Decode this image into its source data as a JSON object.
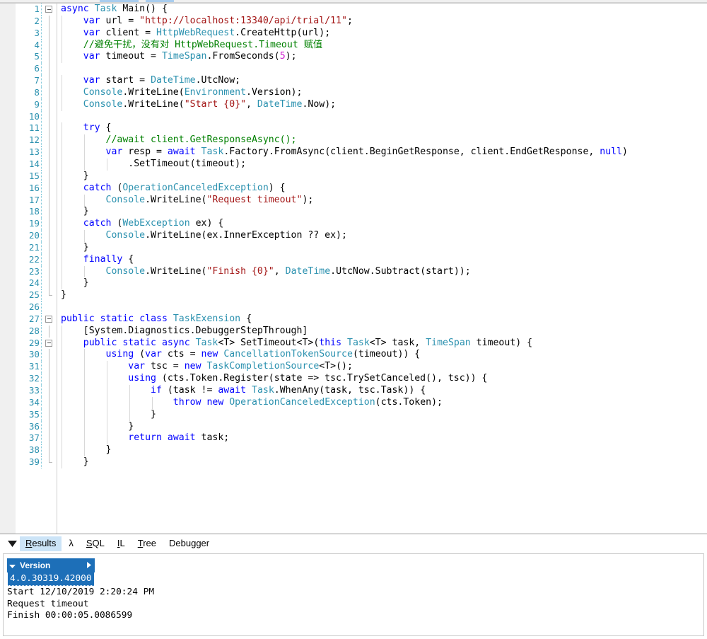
{
  "window": {
    "app": "LINQPad C# Program Editor"
  },
  "editor": {
    "first_line_number": 1,
    "last_line_number": 39,
    "lines": [
      {
        "num": "1",
        "fold": "open",
        "tokens": [
          {
            "t": "k",
            "v": "async"
          },
          {
            "t": "p",
            "v": " "
          },
          {
            "t": "t",
            "v": "Task"
          },
          {
            "t": "p",
            "v": " Main() {"
          }
        ]
      },
      {
        "num": "2",
        "fold": "bar",
        "tokens": [
          {
            "t": "p",
            "v": "    "
          },
          {
            "t": "k",
            "v": "var"
          },
          {
            "t": "p",
            "v": " url = "
          },
          {
            "t": "s",
            "v": "\"http://localhost:13340/api/trial/11\""
          },
          {
            "t": "p",
            "v": ";"
          }
        ]
      },
      {
        "num": "3",
        "fold": "bar",
        "tokens": [
          {
            "t": "p",
            "v": "    "
          },
          {
            "t": "k",
            "v": "var"
          },
          {
            "t": "p",
            "v": " client = "
          },
          {
            "t": "t",
            "v": "HttpWebRequest"
          },
          {
            "t": "p",
            "v": ".CreateHttp(url);"
          }
        ]
      },
      {
        "num": "4",
        "fold": "bar",
        "tokens": [
          {
            "t": "p",
            "v": "    "
          },
          {
            "t": "c",
            "v": "//避免干扰，没有对 HttpWebRequest.Timeout 赋值"
          }
        ]
      },
      {
        "num": "5",
        "fold": "bar",
        "tokens": [
          {
            "t": "p",
            "v": "    "
          },
          {
            "t": "k",
            "v": "var"
          },
          {
            "t": "p",
            "v": " timeout = "
          },
          {
            "t": "t",
            "v": "TimeSpan"
          },
          {
            "t": "p",
            "v": ".FromSeconds("
          },
          {
            "t": "n",
            "v": "5"
          },
          {
            "t": "p",
            "v": ");"
          }
        ]
      },
      {
        "num": "6",
        "fold": "bar",
        "tokens": [
          {
            "t": "p",
            "v": ""
          }
        ]
      },
      {
        "num": "7",
        "fold": "bar",
        "tokens": [
          {
            "t": "p",
            "v": "    "
          },
          {
            "t": "k",
            "v": "var"
          },
          {
            "t": "p",
            "v": " start = "
          },
          {
            "t": "t",
            "v": "DateTime"
          },
          {
            "t": "p",
            "v": ".UtcNow;"
          }
        ]
      },
      {
        "num": "8",
        "fold": "bar",
        "tokens": [
          {
            "t": "p",
            "v": "    "
          },
          {
            "t": "t",
            "v": "Console"
          },
          {
            "t": "p",
            "v": ".WriteLine("
          },
          {
            "t": "t",
            "v": "Environment"
          },
          {
            "t": "p",
            "v": ".Version);"
          }
        ]
      },
      {
        "num": "9",
        "fold": "bar",
        "tokens": [
          {
            "t": "p",
            "v": "    "
          },
          {
            "t": "t",
            "v": "Console"
          },
          {
            "t": "p",
            "v": ".WriteLine("
          },
          {
            "t": "s",
            "v": "\"Start {0}\""
          },
          {
            "t": "p",
            "v": ", "
          },
          {
            "t": "t",
            "v": "DateTime"
          },
          {
            "t": "p",
            "v": ".Now);"
          }
        ]
      },
      {
        "num": "10",
        "fold": "bar",
        "tokens": [
          {
            "t": "p",
            "v": ""
          }
        ]
      },
      {
        "num": "11",
        "fold": "bar",
        "tokens": [
          {
            "t": "p",
            "v": "    "
          },
          {
            "t": "k",
            "v": "try"
          },
          {
            "t": "p",
            "v": " {"
          }
        ]
      },
      {
        "num": "12",
        "fold": "bar",
        "tokens": [
          {
            "t": "p",
            "v": "        "
          },
          {
            "t": "c",
            "v": "//await client.GetResponseAsync();"
          }
        ]
      },
      {
        "num": "13",
        "fold": "bar",
        "tokens": [
          {
            "t": "p",
            "v": "        "
          },
          {
            "t": "k",
            "v": "var"
          },
          {
            "t": "p",
            "v": " resp = "
          },
          {
            "t": "k",
            "v": "await"
          },
          {
            "t": "p",
            "v": " "
          },
          {
            "t": "t",
            "v": "Task"
          },
          {
            "t": "p",
            "v": ".Factory.FromAsync(client.BeginGetResponse, client.EndGetResponse, "
          },
          {
            "t": "k",
            "v": "null"
          },
          {
            "t": "p",
            "v": ")"
          }
        ]
      },
      {
        "num": "14",
        "fold": "bar",
        "tokens": [
          {
            "t": "p",
            "v": "            .SetTimeout(timeout);"
          }
        ]
      },
      {
        "num": "15",
        "fold": "bar",
        "tokens": [
          {
            "t": "p",
            "v": "    }"
          }
        ]
      },
      {
        "num": "16",
        "fold": "bar",
        "tokens": [
          {
            "t": "p",
            "v": "    "
          },
          {
            "t": "k",
            "v": "catch"
          },
          {
            "t": "p",
            "v": " ("
          },
          {
            "t": "t",
            "v": "OperationCanceledException"
          },
          {
            "t": "p",
            "v": ") {"
          }
        ]
      },
      {
        "num": "17",
        "fold": "bar",
        "tokens": [
          {
            "t": "p",
            "v": "        "
          },
          {
            "t": "t",
            "v": "Console"
          },
          {
            "t": "p",
            "v": ".WriteLine("
          },
          {
            "t": "s",
            "v": "\"Request timeout\""
          },
          {
            "t": "p",
            "v": ");"
          }
        ]
      },
      {
        "num": "18",
        "fold": "bar",
        "tokens": [
          {
            "t": "p",
            "v": "    }"
          }
        ]
      },
      {
        "num": "19",
        "fold": "bar",
        "tokens": [
          {
            "t": "p",
            "v": "    "
          },
          {
            "t": "k",
            "v": "catch"
          },
          {
            "t": "p",
            "v": " ("
          },
          {
            "t": "t",
            "v": "WebException"
          },
          {
            "t": "p",
            "v": " ex) {"
          }
        ]
      },
      {
        "num": "20",
        "fold": "bar",
        "tokens": [
          {
            "t": "p",
            "v": "        "
          },
          {
            "t": "t",
            "v": "Console"
          },
          {
            "t": "p",
            "v": ".WriteLine(ex.InnerException ?? ex);"
          }
        ]
      },
      {
        "num": "21",
        "fold": "bar",
        "tokens": [
          {
            "t": "p",
            "v": "    }"
          }
        ]
      },
      {
        "num": "22",
        "fold": "bar",
        "tokens": [
          {
            "t": "p",
            "v": "    "
          },
          {
            "t": "k",
            "v": "finally"
          },
          {
            "t": "p",
            "v": " {"
          }
        ]
      },
      {
        "num": "23",
        "fold": "bar",
        "tokens": [
          {
            "t": "p",
            "v": "        "
          },
          {
            "t": "t",
            "v": "Console"
          },
          {
            "t": "p",
            "v": ".WriteLine("
          },
          {
            "t": "s",
            "v": "\"Finish {0}\""
          },
          {
            "t": "p",
            "v": ", "
          },
          {
            "t": "t",
            "v": "DateTime"
          },
          {
            "t": "p",
            "v": ".UtcNow.Subtract(start));"
          }
        ]
      },
      {
        "num": "24",
        "fold": "bar",
        "tokens": [
          {
            "t": "p",
            "v": "    }"
          }
        ]
      },
      {
        "num": "25",
        "fold": "end",
        "tokens": [
          {
            "t": "p",
            "v": "}"
          }
        ]
      },
      {
        "num": "26",
        "fold": "none",
        "tokens": [
          {
            "t": "p",
            "v": ""
          }
        ]
      },
      {
        "num": "27",
        "fold": "open",
        "tokens": [
          {
            "t": "k",
            "v": "public"
          },
          {
            "t": "p",
            "v": " "
          },
          {
            "t": "k",
            "v": "static"
          },
          {
            "t": "p",
            "v": " "
          },
          {
            "t": "k",
            "v": "class"
          },
          {
            "t": "p",
            "v": " "
          },
          {
            "t": "t",
            "v": "TaskExension"
          },
          {
            "t": "p",
            "v": " {"
          }
        ]
      },
      {
        "num": "28",
        "fold": "bar",
        "tokens": [
          {
            "t": "p",
            "v": "    [System.Diagnostics.DebuggerStepThrough]"
          }
        ]
      },
      {
        "num": "29",
        "fold": "open2",
        "tokens": [
          {
            "t": "p",
            "v": "    "
          },
          {
            "t": "k",
            "v": "public"
          },
          {
            "t": "p",
            "v": " "
          },
          {
            "t": "k",
            "v": "static"
          },
          {
            "t": "p",
            "v": " "
          },
          {
            "t": "k",
            "v": "async"
          },
          {
            "t": "p",
            "v": " "
          },
          {
            "t": "t",
            "v": "Task"
          },
          {
            "t": "p",
            "v": "<T> SetTimeout<T>("
          },
          {
            "t": "k",
            "v": "this"
          },
          {
            "t": "p",
            "v": " "
          },
          {
            "t": "t",
            "v": "Task"
          },
          {
            "t": "p",
            "v": "<T> task, "
          },
          {
            "t": "t",
            "v": "TimeSpan"
          },
          {
            "t": "p",
            "v": " timeout) {"
          }
        ]
      },
      {
        "num": "30",
        "fold": "bar2",
        "tokens": [
          {
            "t": "p",
            "v": "        "
          },
          {
            "t": "k",
            "v": "using"
          },
          {
            "t": "p",
            "v": " ("
          },
          {
            "t": "k",
            "v": "var"
          },
          {
            "t": "p",
            "v": " cts = "
          },
          {
            "t": "k",
            "v": "new"
          },
          {
            "t": "p",
            "v": " "
          },
          {
            "t": "t",
            "v": "CancellationTokenSource"
          },
          {
            "t": "p",
            "v": "(timeout)) {"
          }
        ]
      },
      {
        "num": "31",
        "fold": "bar2",
        "tokens": [
          {
            "t": "p",
            "v": "            "
          },
          {
            "t": "k",
            "v": "var"
          },
          {
            "t": "p",
            "v": " tsc = "
          },
          {
            "t": "k",
            "v": "new"
          },
          {
            "t": "p",
            "v": " "
          },
          {
            "t": "t",
            "v": "TaskCompletionSource"
          },
          {
            "t": "p",
            "v": "<T>();"
          }
        ]
      },
      {
        "num": "32",
        "fold": "bar2",
        "tokens": [
          {
            "t": "p",
            "v": "            "
          },
          {
            "t": "k",
            "v": "using"
          },
          {
            "t": "p",
            "v": " (cts.Token.Register(state => tsc.TrySetCanceled(), tsc)) {"
          }
        ]
      },
      {
        "num": "33",
        "fold": "bar2",
        "tokens": [
          {
            "t": "p",
            "v": "                "
          },
          {
            "t": "k",
            "v": "if"
          },
          {
            "t": "p",
            "v": " (task != "
          },
          {
            "t": "k",
            "v": "await"
          },
          {
            "t": "p",
            "v": " "
          },
          {
            "t": "t",
            "v": "Task"
          },
          {
            "t": "p",
            "v": ".WhenAny(task, tsc.Task)) {"
          }
        ]
      },
      {
        "num": "34",
        "fold": "bar2",
        "tokens": [
          {
            "t": "p",
            "v": "                    "
          },
          {
            "t": "k",
            "v": "throw"
          },
          {
            "t": "p",
            "v": " "
          },
          {
            "t": "k",
            "v": "new"
          },
          {
            "t": "p",
            "v": " "
          },
          {
            "t": "t",
            "v": "OperationCanceledException"
          },
          {
            "t": "p",
            "v": "(cts.Token);"
          }
        ]
      },
      {
        "num": "35",
        "fold": "bar2",
        "tokens": [
          {
            "t": "p",
            "v": "                }"
          }
        ]
      },
      {
        "num": "36",
        "fold": "bar2",
        "tokens": [
          {
            "t": "p",
            "v": "            }"
          }
        ]
      },
      {
        "num": "37",
        "fold": "bar2",
        "tokens": [
          {
            "t": "p",
            "v": "            "
          },
          {
            "t": "k",
            "v": "return"
          },
          {
            "t": "p",
            "v": " "
          },
          {
            "t": "k",
            "v": "await"
          },
          {
            "t": "p",
            "v": " task;"
          }
        ]
      },
      {
        "num": "38",
        "fold": "bar2",
        "tokens": [
          {
            "t": "p",
            "v": "        }"
          }
        ]
      },
      {
        "num": "39",
        "fold": "end2",
        "tokens": [
          {
            "t": "p",
            "v": "    }"
          }
        ]
      }
    ]
  },
  "results": {
    "collapse_icon": "triangle-down-icon",
    "tabs": [
      {
        "id": "results",
        "label": "Results",
        "mnemonic": "R",
        "active": true
      },
      {
        "id": "lambda",
        "label": "λ",
        "mnemonic": "",
        "active": false
      },
      {
        "id": "sql",
        "label": "SQL",
        "mnemonic": "S",
        "active": false
      },
      {
        "id": "il",
        "label": "IL",
        "mnemonic": "I",
        "active": false
      },
      {
        "id": "tree",
        "label": "Tree",
        "mnemonic": "T",
        "active": false
      },
      {
        "id": "debugger",
        "label": "Debugger",
        "mnemonic": "g",
        "active": false
      }
    ],
    "dump_table": {
      "header": "Version",
      "header_left_icon": "chevron-down-icon",
      "header_right_icon": "triangle-right-icon",
      "value": "4.0.30319.42000"
    },
    "console_output": [
      "Start 12/10/2019 2:20:24 PM",
      "Request timeout",
      "Finish 00:00:05.0086599"
    ]
  },
  "colors": {
    "keyword": "#0000FF",
    "type": "#2B91AF",
    "string": "#A31515",
    "comment": "#008000",
    "number": "#D020D0",
    "gutter_number": "#2B91AF",
    "tab_active_bg": "#CCE4F7",
    "dump_header_bg": "#1D6FB8"
  }
}
